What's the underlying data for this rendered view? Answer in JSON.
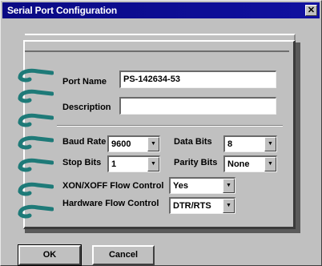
{
  "window": {
    "title": "Serial Port Configuration",
    "close_glyph": "✕"
  },
  "form": {
    "port_name": {
      "label": "Port Name",
      "value": "PS-142634-53"
    },
    "description": {
      "label": "Description",
      "value": ""
    },
    "baud_rate": {
      "label": "Baud Rate",
      "value": "9600"
    },
    "stop_bits": {
      "label": "Stop Bits",
      "value": "1"
    },
    "data_bits": {
      "label": "Data Bits",
      "value": "8"
    },
    "parity_bits": {
      "label": "Parity Bits",
      "value": "None"
    },
    "xon_xoff": {
      "label": "XON/XOFF Flow Control",
      "value": "Yes"
    },
    "hardware_flow": {
      "label": "Hardware Flow Control",
      "value": "DTR/RTS"
    }
  },
  "buttons": {
    "ok": "OK",
    "cancel": "Cancel"
  },
  "colors": {
    "title_bar": "#0a0a84",
    "ring": "#1e7a78",
    "background": "#c0c0c0"
  },
  "icons": {
    "binder_ring": "binder-ring-icon",
    "dropdown": "chevron-down-icon"
  }
}
